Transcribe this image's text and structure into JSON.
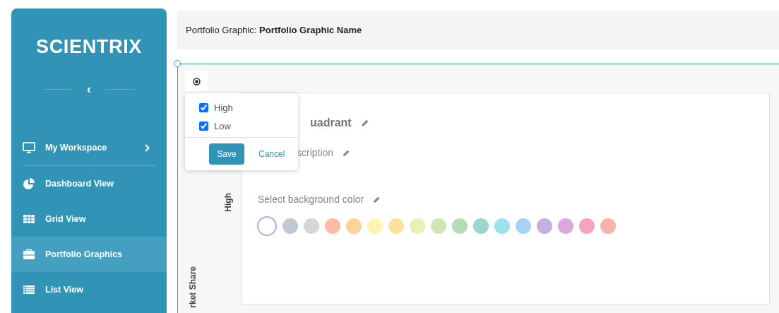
{
  "sidebar": {
    "logo": "SCIENTRIX",
    "collapse_icon": "‹",
    "items": [
      {
        "label": "My Workspace",
        "selected": false,
        "has_submenu": true
      },
      {
        "label": "Dashboard View",
        "selected": false,
        "has_submenu": false
      },
      {
        "label": "Grid View",
        "selected": false,
        "has_submenu": false
      },
      {
        "label": "Portfolio Graphics",
        "selected": true,
        "has_submenu": false
      },
      {
        "label": "List View",
        "selected": false,
        "has_submenu": false
      }
    ]
  },
  "header": {
    "text": "Portfolio Graphic: **Portfolio Graphic Name**"
  },
  "canvas": {
    "y_axis_labels": [
      "High",
      "rket Share"
    ],
    "quadrant": {
      "title": "uadrant",
      "description": "scription",
      "background_label": "Select background color",
      "swatches": [
        {
          "color": "#ffffff",
          "selected": true
        },
        {
          "color": "#bfc9cf",
          "selected": false
        },
        {
          "color": "#d6d6d6",
          "selected": false
        },
        {
          "color": "#ffbba5",
          "selected": false
        },
        {
          "color": "#ffd29a",
          "selected": false
        },
        {
          "color": "#fff5b0",
          "selected": false
        },
        {
          "color": "#ffe29a",
          "selected": false
        },
        {
          "color": "#e9f0b5",
          "selected": false
        },
        {
          "color": "#d1e6b8",
          "selected": false
        },
        {
          "color": "#b3ddb6",
          "selected": false
        },
        {
          "color": "#98d6ce",
          "selected": false
        },
        {
          "color": "#9be2ec",
          "selected": false
        },
        {
          "color": "#a6d3f5",
          "selected": false
        },
        {
          "color": "#c3b0e0",
          "selected": false
        },
        {
          "color": "#d8a9dd",
          "selected": false
        },
        {
          "color": "#f4a5bd",
          "selected": false
        },
        {
          "color": "#f9b3ab",
          "selected": false
        }
      ]
    }
  },
  "popup": {
    "options": [
      {
        "label": "High",
        "checked": true
      },
      {
        "label": "Low",
        "checked": true
      }
    ],
    "save": "Save",
    "cancel": "Cancel"
  }
}
